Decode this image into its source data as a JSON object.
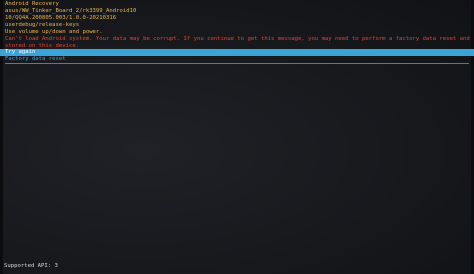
{
  "header": {
    "title": "Android Recovery",
    "lines": [
      "asus/WW_Tinker_Board_2/rk3399_Android10",
      "10/QQ4A.200805.003/1.0.0-20210316",
      "userdebug/release-keys",
      "Use volume up/down and power."
    ],
    "warning_lines": [
      "Can't load Android system. Your data may be corrupt. If you continue to get this message, you may need to perform a factory data reset and erase all user data",
      "stored on this device."
    ]
  },
  "menu": {
    "items": [
      {
        "label": "Try again",
        "selected": true
      },
      {
        "label": "Factory data reset",
        "selected": false
      }
    ]
  },
  "footer": {
    "text": "Supported API: 3"
  },
  "colors": {
    "header_text": "#e8b74a",
    "warning_text": "#e04636",
    "menu_accent": "#3aa3d8",
    "background": "#17181c"
  }
}
